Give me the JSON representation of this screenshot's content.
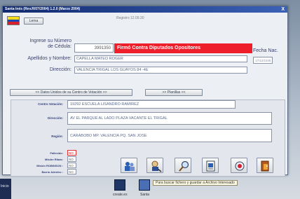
{
  "window": {
    "title": "Santa Inés (Rev.R/07/2004) 1.2.0 (Marzo 2004)",
    "close_glyph": "X"
  },
  "header": {
    "small_button": "Lema",
    "registro": "Registro 12.09.30"
  },
  "form": {
    "cedula_label": "Ingrese su Número\nde Cédula:",
    "cedula_value": "3991350",
    "alert_text": "Firmó Contra Diputados Opositores",
    "nombre_label": "Apellidos y Nombre:",
    "nombre_value": "CAPELLA MATEO ROGER",
    "direccion_label": "Dirección:",
    "direccion_value": "VALENCIA TRIGAL LOS GUAYOS 84 -4E",
    "fecha_label": "Fecha Nac.",
    "fecha_value": "17/12/1945"
  },
  "tabs": {
    "left": "<< Datos Unidos de su Centro de Votación >>",
    "right": ">> Planillas <<"
  },
  "section": {
    "centro_label": "Centro Votación:",
    "centro_value": "19292 ESCUELA LISANDRO RAMIREZ",
    "direccion_label": "Dirección:",
    "direccion_value": "AV EL PARQUE AL LADO PLAZA VACANTE EL TRIGAL",
    "region_label": "Región:",
    "region_value": "CARABOBO MP. VALENCIA PQ. SAN JOSE",
    "checks": [
      {
        "label": "Fallecido:",
        "value": "NO",
        "red": true
      },
      {
        "label": "Misión Ribas:",
        "value": "NO",
        "red": false
      },
      {
        "label": "Misión ROBINSON :",
        "value": "NO",
        "red": false
      },
      {
        "label": "Barrio Adentro :",
        "value": "NO",
        "red": false
      }
    ]
  },
  "icons": [
    {
      "name": "people-icon"
    },
    {
      "name": "search-person-icon"
    },
    {
      "name": "magnifier-icon"
    },
    {
      "name": "document-icon"
    },
    {
      "name": "globe-icon"
    },
    {
      "name": "exit-icon"
    }
  ],
  "tooltip": "Para buscar fichero y guardar a Archivo Interesado",
  "desktop": {
    "icon1_label": "create.ex",
    "icon2_label": "Santa",
    "taskbar_label": "Inicio"
  },
  "colors": {
    "titlebar": "#112a6e",
    "alert": "#ee1e2a",
    "flag_yellow": "#f8dd1a",
    "flag_blue": "#1c46b0",
    "flag_red": "#d6202b"
  }
}
